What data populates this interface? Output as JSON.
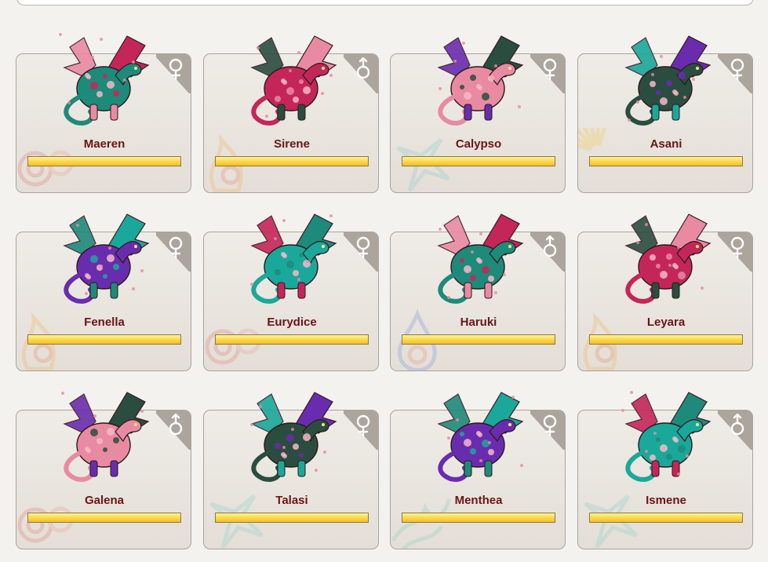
{
  "colors": {
    "name_text": "#6b1414",
    "card_border": "#a9a49c",
    "corner_tab": "#aba59d",
    "bar_fill": "#fcd64a",
    "dragon_palette": [
      "#1e8a7a",
      "#c4265a",
      "#e98aa3",
      "#2a4d3f",
      "#6a2cae",
      "#1aa89a"
    ]
  },
  "dragons": [
    {
      "name": "Maeren",
      "gender": "female",
      "gender_icon": "female-icon",
      "progress": 1.0,
      "bg_icon": "swirl-icon"
    },
    {
      "name": "Sirene",
      "gender": "male",
      "gender_icon": "male-icon",
      "progress": 1.0,
      "bg_icon": "flame-icon"
    },
    {
      "name": "Calypso",
      "gender": "female",
      "gender_icon": "female-icon",
      "progress": 1.0,
      "bg_icon": "star-icon"
    },
    {
      "name": "Asani",
      "gender": "female",
      "gender_icon": "female-icon",
      "progress": 1.0,
      "bg_icon": "sunburst-icon"
    },
    {
      "name": "Fenella",
      "gender": "female",
      "gender_icon": "female-icon",
      "progress": 1.0,
      "bg_icon": "flame-icon"
    },
    {
      "name": "Eurydice",
      "gender": "female",
      "gender_icon": "female-icon",
      "progress": 1.0,
      "bg_icon": "swirl-icon"
    },
    {
      "name": "Haruki",
      "gender": "male",
      "gender_icon": "male-icon",
      "progress": 1.0,
      "bg_icon": "drop-icon"
    },
    {
      "name": "Leyara",
      "gender": "female",
      "gender_icon": "female-icon",
      "progress": 1.0,
      "bg_icon": "flame-icon"
    },
    {
      "name": "Galena",
      "gender": "male",
      "gender_icon": "male-icon",
      "progress": 1.0,
      "bg_icon": "swirl-icon"
    },
    {
      "name": "Talasi",
      "gender": "female",
      "gender_icon": "female-icon",
      "progress": 1.0,
      "bg_icon": "star-icon"
    },
    {
      "name": "Menthea",
      "gender": "female",
      "gender_icon": "female-icon",
      "progress": 1.0,
      "bg_icon": "leaf-icon"
    },
    {
      "name": "Ismene",
      "gender": "male",
      "gender_icon": "male-icon",
      "progress": 1.0,
      "bg_icon": "star-icon"
    }
  ]
}
